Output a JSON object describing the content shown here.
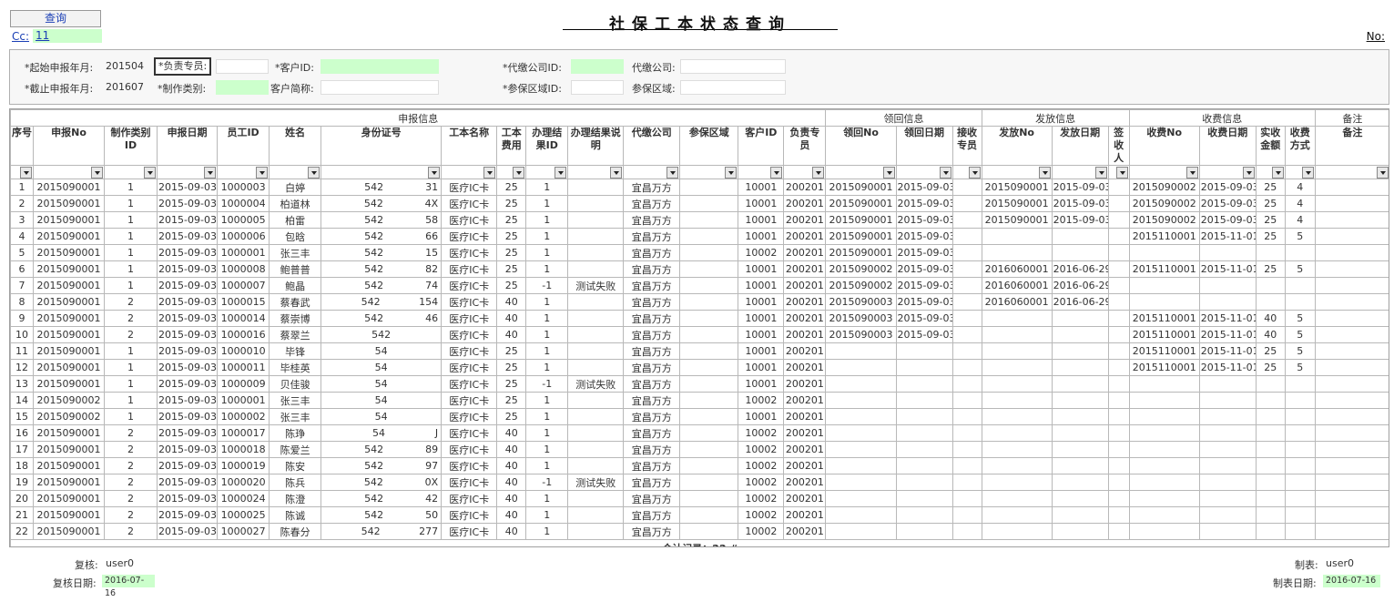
{
  "header": {
    "query_label": "查询",
    "cc_label": "Cc:",
    "cc_value": "11",
    "title": "社保工本状态查询",
    "no_label": "No:"
  },
  "filters": {
    "start_month_label": "*起始申报年月:",
    "start_month_value": "201504",
    "end_month_label": "*截止申报年月:",
    "end_month_value": "201607",
    "staff_label": "*负责专员:",
    "make_type_label": "*制作类别:",
    "customer_id_label": "*客户ID:",
    "customer_short_label": "客户简称:",
    "agent_id_label": "*代缴公司ID:",
    "agent_label": "代缴公司:",
    "area_id_label": "*参保区域ID:",
    "area_label": "参保区域:"
  },
  "groups": {
    "apply": "申报信息",
    "receive": "领回信息",
    "issue": "发放信息",
    "charge": "收费信息",
    "remark": "备注"
  },
  "columns": [
    "序号",
    "申报No",
    "制作类别ID",
    "申报日期",
    "员工ID",
    "姓名",
    "身份证号",
    "工本名称",
    "工本费用",
    "办理结果ID",
    "办理结果说明",
    "代缴公司",
    "参保区域",
    "客户ID",
    "负责专员",
    "领回No",
    "领回日期",
    "接收专员",
    "发放No",
    "发放日期",
    "签收人",
    "收费No",
    "收费日期",
    "实收金额",
    "收费方式",
    "备注"
  ],
  "rows": [
    [
      "1",
      "2015090001",
      "1",
      "2015-09-03",
      "1000003",
      "白婷",
      "542",
      "31",
      "医疗IC卡",
      "25",
      "1",
      "",
      "宜昌万方",
      "",
      "10001",
      "200201",
      "2015090001",
      "2015-09-03",
      "",
      "2015090001",
      "2015-09-03",
      "",
      "2015090002",
      "2015-09-03",
      "25",
      "4"
    ],
    [
      "2",
      "2015090001",
      "1",
      "2015-09-03",
      "1000004",
      "柏道林",
      "542",
      "4X",
      "医疗IC卡",
      "25",
      "1",
      "",
      "宜昌万方",
      "",
      "10001",
      "200201",
      "2015090001",
      "2015-09-03",
      "",
      "2015090001",
      "2015-09-03",
      "",
      "2015090002",
      "2015-09-03",
      "25",
      "4"
    ],
    [
      "3",
      "2015090001",
      "1",
      "2015-09-03",
      "1000005",
      "柏雷",
      "542",
      "58",
      "医疗IC卡",
      "25",
      "1",
      "",
      "宜昌万方",
      "",
      "10001",
      "200201",
      "2015090001",
      "2015-09-03",
      "",
      "2015090001",
      "2015-09-03",
      "",
      "2015090002",
      "2015-09-03",
      "25",
      "4"
    ],
    [
      "4",
      "2015090001",
      "1",
      "2015-09-03",
      "1000006",
      "包晗",
      "542",
      "66",
      "医疗IC卡",
      "25",
      "1",
      "",
      "宜昌万方",
      "",
      "10001",
      "200201",
      "2015090001",
      "2015-09-03",
      "",
      "",
      "",
      "",
      "2015110001",
      "2015-11-01",
      "25",
      "5"
    ],
    [
      "5",
      "2015090001",
      "1",
      "2015-09-03",
      "1000001",
      "张三丰",
      "542",
      "15",
      "医疗IC卡",
      "25",
      "1",
      "",
      "宜昌万方",
      "",
      "10002",
      "200201",
      "2015090001",
      "2015-09-03",
      "",
      "",
      "",
      "",
      "",
      "",
      "",
      ""
    ],
    [
      "6",
      "2015090001",
      "1",
      "2015-09-03",
      "1000008",
      "鲍普普",
      "542",
      "82",
      "医疗IC卡",
      "25",
      "1",
      "",
      "宜昌万方",
      "",
      "10001",
      "200201",
      "2015090002",
      "2015-09-03",
      "",
      "2016060001",
      "2016-06-29",
      "",
      "2015110001",
      "2015-11-01",
      "25",
      "5"
    ],
    [
      "7",
      "2015090001",
      "1",
      "2015-09-03",
      "1000007",
      "鲍晶",
      "542",
      "74",
      "医疗IC卡",
      "25",
      "-1",
      "测试失败",
      "宜昌万方",
      "",
      "10001",
      "200201",
      "2015090002",
      "2015-09-03",
      "",
      "2016060001",
      "2016-06-29",
      "",
      "",
      "",
      "",
      ""
    ],
    [
      "8",
      "2015090001",
      "2",
      "2015-09-03",
      "1000015",
      "蔡春武",
      "542",
      "154",
      "医疗IC卡",
      "40",
      "1",
      "",
      "宜昌万方",
      "",
      "10001",
      "200201",
      "2015090003",
      "2015-09-03",
      "",
      "2016060001",
      "2016-06-29",
      "",
      "",
      "",
      "",
      ""
    ],
    [
      "9",
      "2015090001",
      "2",
      "2015-09-03",
      "1000014",
      "蔡崇博",
      "542",
      "46",
      "医疗IC卡",
      "40",
      "1",
      "",
      "宜昌万方",
      "",
      "10001",
      "200201",
      "2015090003",
      "2015-09-03",
      "",
      "",
      "",
      "",
      "2015110001",
      "2015-11-01",
      "40",
      "5"
    ],
    [
      "10",
      "2015090001",
      "2",
      "2015-09-03",
      "1000016",
      "蔡翠兰",
      "542",
      "",
      "医疗IC卡",
      "40",
      "1",
      "",
      "宜昌万方",
      "",
      "10001",
      "200201",
      "2015090003",
      "2015-09-03",
      "",
      "",
      "",
      "",
      "2015110001",
      "2015-11-01",
      "40",
      "5"
    ],
    [
      "11",
      "2015090001",
      "1",
      "2015-09-03",
      "1000010",
      "毕锋",
      "54",
      "",
      "医疗IC卡",
      "25",
      "1",
      "",
      "宜昌万方",
      "",
      "10001",
      "200201",
      "",
      "",
      "",
      "",
      "",
      "",
      "2015110001",
      "2015-11-01",
      "25",
      "5"
    ],
    [
      "12",
      "2015090001",
      "1",
      "2015-09-03",
      "1000011",
      "毕桂英",
      "54",
      "",
      "医疗IC卡",
      "25",
      "1",
      "",
      "宜昌万方",
      "",
      "10001",
      "200201",
      "",
      "",
      "",
      "",
      "",
      "",
      "2015110001",
      "2015-11-01",
      "25",
      "5"
    ],
    [
      "13",
      "2015090001",
      "1",
      "2015-09-03",
      "1000009",
      "贝佳骏",
      "54",
      "",
      "医疗IC卡",
      "25",
      "-1",
      "测试失败",
      "宜昌万方",
      "",
      "10001",
      "200201",
      "",
      "",
      "",
      "",
      "",
      "",
      "",
      "",
      "",
      ""
    ],
    [
      "14",
      "2015090002",
      "1",
      "2015-09-03",
      "1000001",
      "张三丰",
      "54",
      "",
      "医疗IC卡",
      "25",
      "1",
      "",
      "宜昌万方",
      "",
      "10002",
      "200201",
      "",
      "",
      "",
      "",
      "",
      "",
      "",
      "",
      "",
      ""
    ],
    [
      "15",
      "2015090002",
      "1",
      "2015-09-03",
      "1000002",
      "张三丰",
      "54",
      "",
      "医疗IC卡",
      "25",
      "1",
      "",
      "宜昌万方",
      "",
      "10001",
      "200201",
      "",
      "",
      "",
      "",
      "",
      "",
      "",
      "",
      "",
      ""
    ],
    [
      "16",
      "2015090001",
      "2",
      "2015-09-03",
      "1000017",
      "陈琤",
      "54",
      "J",
      "医疗IC卡",
      "40",
      "1",
      "",
      "宜昌万方",
      "",
      "10002",
      "200201",
      "",
      "",
      "",
      "",
      "",
      "",
      "",
      "",
      "",
      ""
    ],
    [
      "17",
      "2015090001",
      "2",
      "2015-09-03",
      "1000018",
      "陈爱兰",
      "542",
      "89",
      "医疗IC卡",
      "40",
      "1",
      "",
      "宜昌万方",
      "",
      "10002",
      "200201",
      "",
      "",
      "",
      "",
      "",
      "",
      "",
      "",
      "",
      ""
    ],
    [
      "18",
      "2015090001",
      "2",
      "2015-09-03",
      "1000019",
      "陈安",
      "542",
      "97",
      "医疗IC卡",
      "40",
      "1",
      "",
      "宜昌万方",
      "",
      "10002",
      "200201",
      "",
      "",
      "",
      "",
      "",
      "",
      "",
      "",
      "",
      ""
    ],
    [
      "19",
      "2015090001",
      "2",
      "2015-09-03",
      "1000020",
      "陈兵",
      "542",
      "0X",
      "医疗IC卡",
      "40",
      "-1",
      "测试失败",
      "宜昌万方",
      "",
      "10002",
      "200201",
      "",
      "",
      "",
      "",
      "",
      "",
      "",
      "",
      "",
      ""
    ],
    [
      "20",
      "2015090001",
      "2",
      "2015-09-03",
      "1000024",
      "陈澄",
      "542",
      "42",
      "医疗IC卡",
      "40",
      "1",
      "",
      "宜昌万方",
      "",
      "10002",
      "200201",
      "",
      "",
      "",
      "",
      "",
      "",
      "",
      "",
      "",
      ""
    ],
    [
      "21",
      "2015090001",
      "2",
      "2015-09-03",
      "1000025",
      "陈诚",
      "542",
      "50",
      "医疗IC卡",
      "40",
      "1",
      "",
      "宜昌万方",
      "",
      "10002",
      "200201",
      "",
      "",
      "",
      "",
      "",
      "",
      "",
      "",
      "",
      ""
    ],
    [
      "22",
      "2015090001",
      "2",
      "2015-09-03",
      "1000027",
      "陈春分",
      "542",
      "277",
      "医疗IC卡",
      "40",
      "1",
      "",
      "宜昌万方",
      "",
      "10002",
      "200201",
      "",
      "",
      "",
      "",
      "",
      "",
      "",
      "",
      "",
      ""
    ]
  ],
  "total_label": "合计记录：22 #",
  "footer": {
    "review_label": "复核:",
    "review_value": "user0",
    "review_date_label": "复核日期:",
    "review_date_value": "2016-07-16",
    "maker_label": "制表:",
    "maker_value": "user0",
    "maker_date_label": "制表日期:",
    "maker_date_value": "2016-07-16"
  },
  "colors": {
    "accent": "#1a3fb5",
    "green_field": "#ccffcc",
    "border": "#b8b8b8"
  }
}
